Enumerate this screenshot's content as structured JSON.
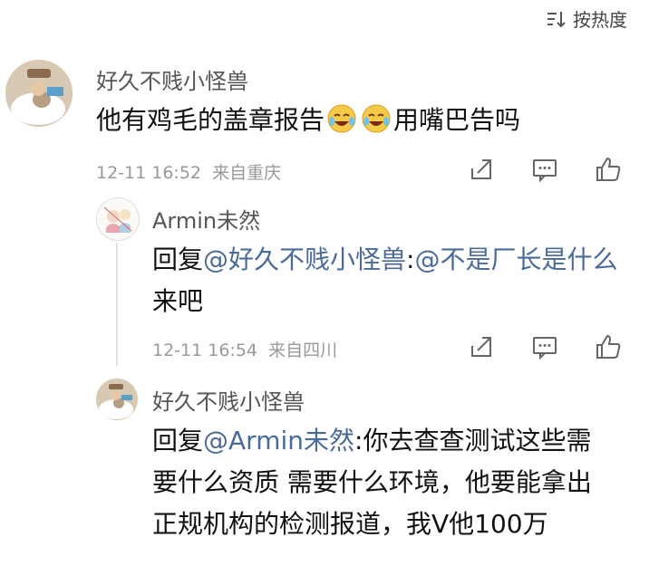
{
  "sort": {
    "label": "按热度"
  },
  "comments": [
    {
      "username": "好久不贱小怪兽",
      "text_before": "他有鸡毛的盖章报告",
      "text_after": "用嘴巴告吗",
      "time": "12-11 16:52",
      "location": "来自重庆"
    },
    {
      "username": "Armin未然",
      "reply_prefix": "回复",
      "mention": "@好久不贱小怪兽",
      "colon": ":",
      "mention2": "@不是厂长是什么",
      "text": " 来吧",
      "time": "12-11 16:54",
      "location": "来自四川"
    },
    {
      "username": "好久不贱小怪兽",
      "reply_prefix": "回复",
      "mention": "@Armin未然",
      "colon": ":",
      "text": "你去查查测试这些需要什么资质 需要什么环境，他要能拿出正规机构的检测报道，我V他100万"
    }
  ],
  "icons": {
    "sort": "sort-icon",
    "share": "share-icon",
    "comment": "comment-icon",
    "like": "like-icon",
    "emoji": "laugh-cry-emoji"
  }
}
